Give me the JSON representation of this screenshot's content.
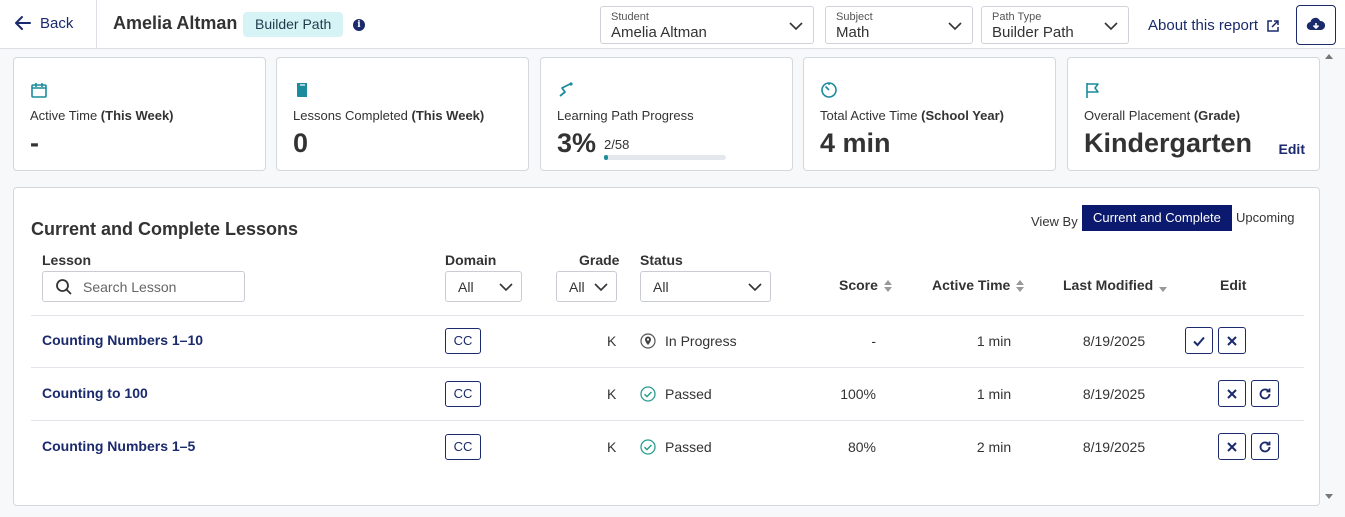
{
  "header": {
    "back_label": "Back",
    "student_name": "Amelia Altman",
    "path_badge": "Builder Path",
    "selects": [
      {
        "label": "Student",
        "value": "Amelia Altman"
      },
      {
        "label": "Subject",
        "value": "Math"
      },
      {
        "label": "Path Type",
        "value": "Builder Path"
      }
    ],
    "about_label": "About this report"
  },
  "cards": [
    {
      "icon": "calendar-icon",
      "label": "Active Time ",
      "label_bold": "(This Week)",
      "value": "-"
    },
    {
      "icon": "book-icon",
      "label": "Lessons Completed ",
      "label_bold": "(This Week)",
      "value": "0"
    },
    {
      "icon": "path-icon",
      "label": "Learning Path Progress",
      "label_bold": "",
      "value": "3%",
      "sub": "2/58",
      "progress": 0.034
    },
    {
      "icon": "timer-icon",
      "label": "Total Active Time ",
      "label_bold": "(School Year)",
      "value": "4 min"
    },
    {
      "icon": "flag-icon",
      "label": "Overall Placement ",
      "label_bold": "(Grade)",
      "value": "Kindergarten",
      "edit": "Edit"
    }
  ],
  "panel": {
    "title": "Current and Complete Lessons",
    "view_by": "View By",
    "seg_active": "Current and Complete",
    "seg_inactive": "Upcoming",
    "columns": {
      "lesson": "Lesson",
      "domain": "Domain",
      "grade": "Grade",
      "status": "Status",
      "score": "Score",
      "active_time": "Active Time",
      "last_modified": "Last Modified",
      "edit": "Edit"
    },
    "search_placeholder": "Search Lesson",
    "domain_filter": "All",
    "grade_filter": "All",
    "status_filter": "All",
    "rows": [
      {
        "lesson": "Counting Numbers 1–10",
        "domain": "CC",
        "grade": "K",
        "status": "In Progress",
        "score": "-",
        "active_time": "1 min",
        "last_modified": "8/19/2025",
        "actions": [
          "check",
          "close"
        ]
      },
      {
        "lesson": "Counting to 100",
        "domain": "CC",
        "grade": "K",
        "status": "Passed",
        "score": "100%",
        "active_time": "1 min",
        "last_modified": "8/19/2025",
        "actions": [
          "close",
          "refresh"
        ]
      },
      {
        "lesson": "Counting Numbers 1–5",
        "domain": "CC",
        "grade": "K",
        "status": "Passed",
        "score": "80%",
        "active_time": "2 min",
        "last_modified": "8/19/2025",
        "actions": [
          "close",
          "refresh"
        ]
      }
    ]
  },
  "colors": {
    "navy": "#1a2a6c",
    "teal": "#1c8c9c",
    "badge_bg": "#d6f3f6"
  }
}
